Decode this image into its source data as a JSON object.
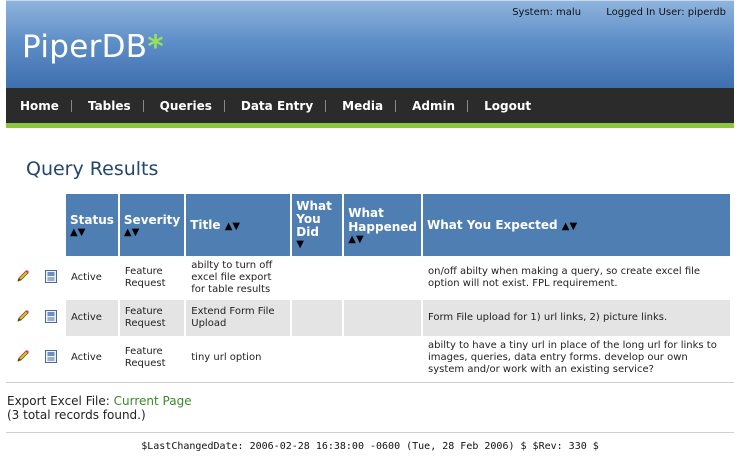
{
  "header": {
    "system": "System: malu",
    "logged_in": "Logged In User: piperdb",
    "logo_main": "Piper",
    "logo_db": "DB",
    "logo_star": "*"
  },
  "nav": [
    "Home",
    "Tables",
    "Queries",
    "Data Entry",
    "Media",
    "Admin",
    "Logout"
  ],
  "page_title": "Query Results",
  "table": {
    "headers": [
      "Status",
      "Severity",
      "Title",
      "What You Did",
      "What Happened",
      "What You Expected"
    ],
    "sort_glyphs": "▲▼",
    "rows": [
      {
        "status": "Active",
        "severity": "Feature Request",
        "title": "abilty to turn off excel file export for table results",
        "did": "",
        "happened": "",
        "expected": "on/off abilty when making a query, so create excel file option will not exist. FPL requirement."
      },
      {
        "status": "Active",
        "severity": "Feature Request",
        "title": "Extend Form File Upload",
        "did": "",
        "happened": "",
        "expected": "Form File upload for 1) url links, 2) picture links."
      },
      {
        "status": "Active",
        "severity": "Feature Request",
        "title": "tiny url option",
        "did": "",
        "happened": "",
        "expected": "abilty to have a tiny url in place of the long url for links to images, queries, data entry forms. develop our own system and/or work with an existing service?"
      }
    ]
  },
  "export": {
    "label": "Export Excel File:",
    "link": "Current Page",
    "count": "(3 total records found.)"
  },
  "footer": "$LastChangedDate: 2006-02-28 16:38:00 -0600 (Tue, 28 Feb 2006) $ $Rev: 330 $",
  "colors": {
    "header_blue": "#3d6fae",
    "nav_bg": "#2b2b2b",
    "nav_accent": "#8cc63f",
    "th_bg": "#4f7eb3",
    "link_green": "#3a8a2a"
  },
  "icons": [
    "pencil-icon",
    "document-icon",
    "sort-up-icon",
    "sort-down-icon"
  ]
}
